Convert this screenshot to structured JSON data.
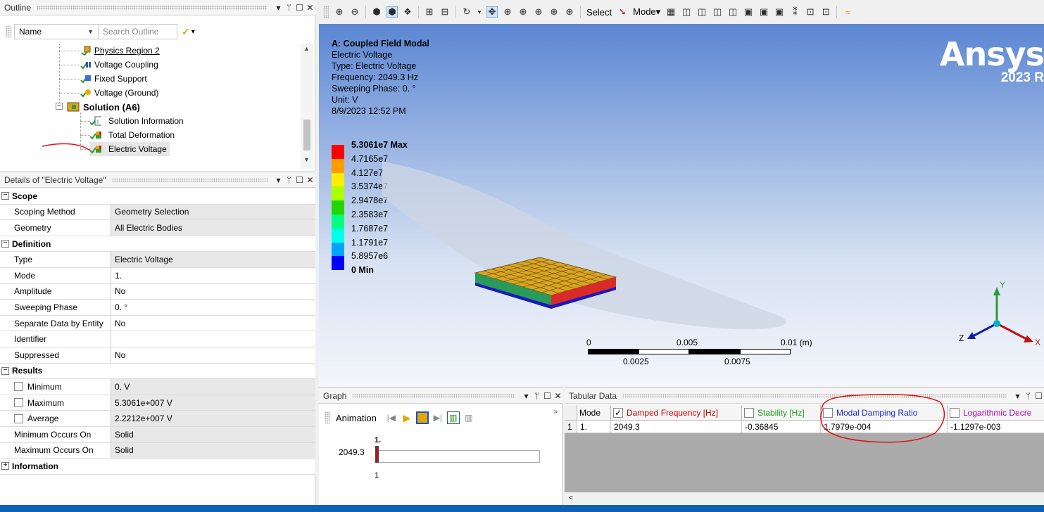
{
  "outline": {
    "title": "Outline",
    "name_dropdown": "Name",
    "search_placeholder": "Search Outline",
    "items": [
      {
        "label": "Physics Region 2",
        "icon": "physics-region-icon"
      },
      {
        "label": "Voltage Coupling",
        "icon": "voltage-coupling-icon"
      },
      {
        "label": "Fixed Support",
        "icon": "fixed-support-icon"
      },
      {
        "label": "Voltage (Ground)",
        "icon": "voltage-ground-icon"
      },
      {
        "label": "Solution (A6)",
        "icon": "solution-icon"
      },
      {
        "label": "Solution Information",
        "icon": "solution-information-icon"
      },
      {
        "label": "Total Deformation",
        "icon": "result-icon"
      },
      {
        "label": "Electric Voltage",
        "icon": "result-icon"
      }
    ]
  },
  "details": {
    "title": "Details of \"Electric Voltage\"",
    "sections": {
      "scope": "Scope",
      "definition": "Definition",
      "results": "Results",
      "information": "Information"
    },
    "rows": {
      "scoping_method": {
        "k": "Scoping Method",
        "v": "Geometry Selection"
      },
      "geometry": {
        "k": "Geometry",
        "v": "All Electric Bodies"
      },
      "type": {
        "k": "Type",
        "v": "Electric Voltage"
      },
      "mode": {
        "k": "Mode",
        "v": "1."
      },
      "amplitude": {
        "k": "Amplitude",
        "v": "No"
      },
      "sweeping_phase": {
        "k": "Sweeping Phase",
        "v": "0. °"
      },
      "separate": {
        "k": "Separate Data by Entity",
        "v": "No"
      },
      "identifier": {
        "k": "Identifier",
        "v": ""
      },
      "suppressed": {
        "k": "Suppressed",
        "v": "No"
      },
      "minimum": {
        "k": "Minimum",
        "v": "0. V"
      },
      "maximum": {
        "k": "Maximum",
        "v": "5.3061e+007 V"
      },
      "average": {
        "k": "Average",
        "v": "2.2212e+007 V"
      },
      "min_occurs": {
        "k": "Minimum Occurs On",
        "v": "Solid"
      },
      "max_occurs": {
        "k": "Maximum Occurs On",
        "v": "Solid"
      }
    }
  },
  "toolbar": {
    "select_label": "Select",
    "mode_label": "Mode▾"
  },
  "viewport": {
    "info": {
      "title": "A: Coupled Field Modal",
      "result": "Electric Voltage",
      "type": "Type: Electric Voltage",
      "frequency": "Frequency: 2049.3 Hz",
      "phase": "Sweeping Phase: 0. °",
      "unit": "Unit: V",
      "date": "8/9/2023 12:52 PM"
    },
    "legend": {
      "max": "5.3061e7 Max",
      "levels": [
        "4.7165e7",
        "4.127e7",
        "3.5374e7",
        "2.9478e7",
        "2.3583e7",
        "1.7687e7",
        "1.1791e7",
        "5.8957e6"
      ],
      "min": "0 Min",
      "colors": [
        "#ff0000",
        "#ff9b00",
        "#ffee00",
        "#aaff00",
        "#22d700",
        "#00ff7f",
        "#00ffe8",
        "#00a4ff",
        "#0000ff"
      ]
    },
    "brand": {
      "name": "Ansys",
      "version": "2023 R"
    },
    "scale": {
      "l0": "0",
      "l1": "0.005",
      "l2": "0.01 (m)",
      "l3": "0.0025",
      "l4": "0.0075"
    },
    "triad": {
      "x": "X",
      "y": "Y",
      "z": "Z"
    }
  },
  "graph": {
    "title": "Graph",
    "animation_label": "Animation",
    "axis_value": "2049.3",
    "mode_top": "1.",
    "mode_bottom": "1"
  },
  "tabular": {
    "title": "Tabular Data",
    "columns": [
      "Mode",
      "Damped Frequency [Hz]",
      "Stability [Hz]",
      "Modal Damping Ratio",
      "Logarithmic Decre"
    ],
    "column_colors": [
      "#000000",
      "#d40000",
      "#1f9a1f",
      "#1f2fd0",
      "#b000b0"
    ],
    "row": {
      "index": "1",
      "mode": "1.",
      "damped_freq": "2049.3",
      "stability": "-0.36845",
      "damping_ratio": "1.7979e-004",
      "log_decrement": "-1.1297e-003"
    }
  }
}
